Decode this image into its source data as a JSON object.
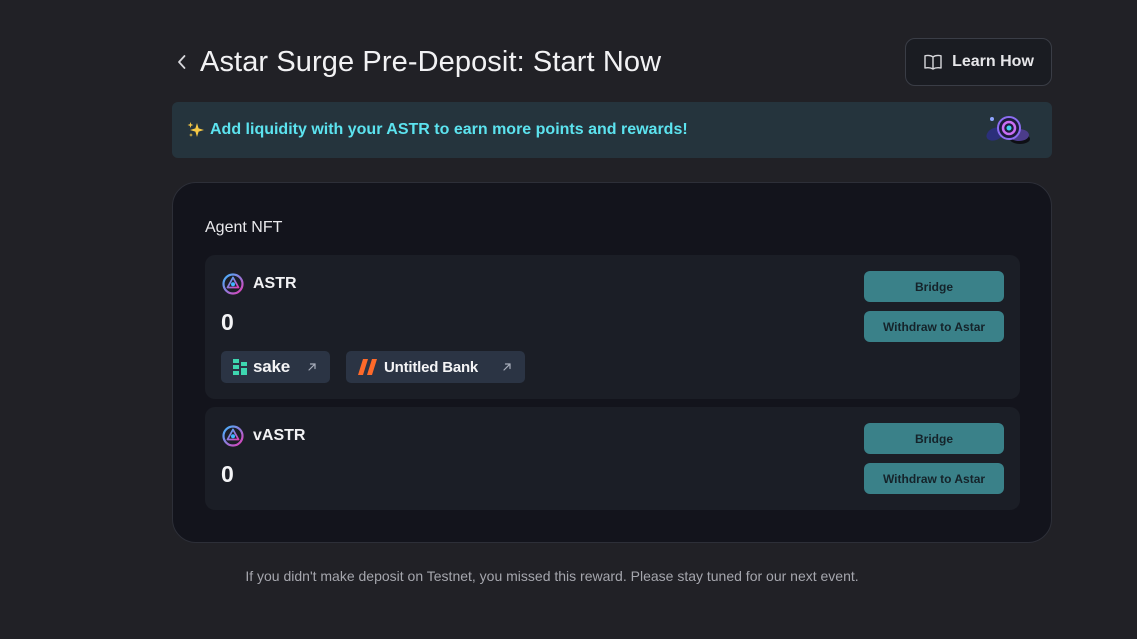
{
  "header": {
    "title": "Astar Surge Pre-Deposit: Start Now",
    "learn_label": "Learn How"
  },
  "banner": {
    "text": "Add liquidity with your ASTR to earn more points and rewards!"
  },
  "card": {
    "title": "Agent NFT",
    "tokens": [
      {
        "name": "ASTR",
        "amount": "0",
        "bridge_label": "Bridge",
        "withdraw_label": "Withdraw to Astar",
        "partners": [
          {
            "name": "sake"
          },
          {
            "name": "Untitled Bank"
          }
        ]
      },
      {
        "name": "vASTR",
        "amount": "0",
        "bridge_label": "Bridge",
        "withdraw_label": "Withdraw to Astar"
      }
    ]
  },
  "footnote": "If you didn't make deposit on Testnet, you missed this reward. Please stay tuned for our next event.",
  "colors": {
    "background": "#212126",
    "accent_teal": "#3a8189",
    "banner_text": "#5ce3ef",
    "card_bg": "#13141c"
  },
  "icons": {
    "back": "chevron-left-icon",
    "learn": "book-icon",
    "banner": "sparkle-icon",
    "token": "astar-logo-icon",
    "partner_link": "external-link-icon"
  }
}
